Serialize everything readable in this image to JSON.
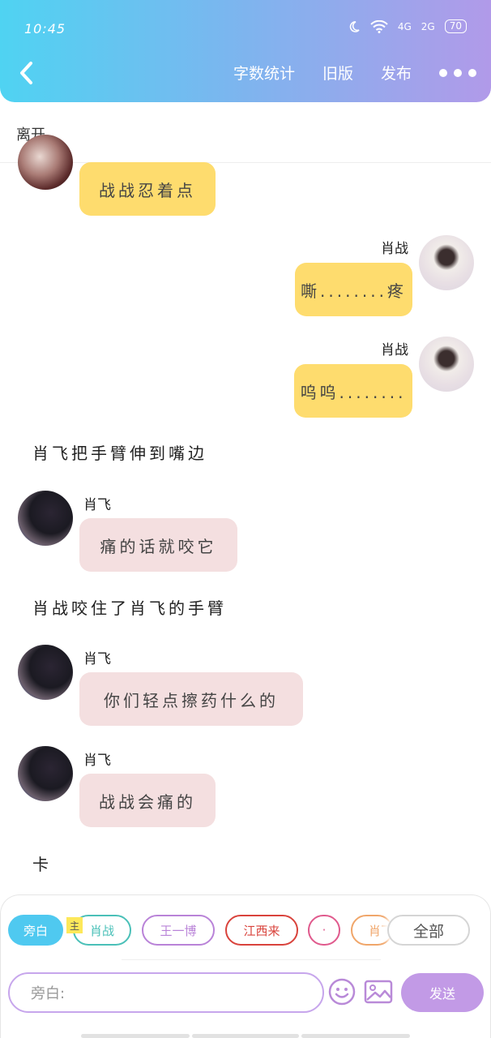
{
  "status": {
    "time": "10:45",
    "network1": "4G",
    "network2": "2G",
    "battery": "70"
  },
  "nav": {
    "stats": "字数统计",
    "old_version": "旧版",
    "publish": "发布"
  },
  "left_note": "离开",
  "messages": {
    "m1": {
      "text": "战战忍着点"
    },
    "m2": {
      "name": "肖战",
      "text": "嘶........疼"
    },
    "m3": {
      "name": "肖战",
      "text": "呜呜........"
    },
    "n1": "肖飞把手臂伸到嘴边",
    "m4": {
      "name": "肖飞",
      "text": "痛的话就咬它"
    },
    "n2": "肖战咬住了肖飞的手臂",
    "m5": {
      "name": "肖飞",
      "text": "你们轻点擦药什么的"
    },
    "m6": {
      "name": "肖飞",
      "text": "战战会痛的"
    },
    "n3": "卡"
  },
  "roles": {
    "narration": "旁白",
    "host_tag": "主",
    "xz": "肖战",
    "wyb": "王一博",
    "jxl": "江西来",
    "dot": "·",
    "xf": "肖飞",
    "all": "全部"
  },
  "composer": {
    "placeholder": "旁白:",
    "send": "发送"
  },
  "colors": {
    "accent_start": "#4fd3f2",
    "accent_end": "#b19ae9",
    "yellow_bubble": "#fedc6e",
    "pink_bubble": "#f4dfe0"
  }
}
